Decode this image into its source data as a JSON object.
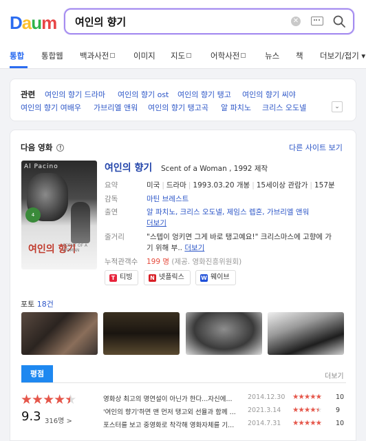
{
  "header": {
    "logo": "Daum",
    "search_value": "여인의 향기"
  },
  "tabs": [
    "통합",
    "통합웹",
    "백과사전",
    "이미지",
    "지도",
    "어학사전",
    "뉴스",
    "책",
    "더보기/접기"
  ],
  "related": {
    "title": "관련",
    "links": [
      "여인의 향기 드라마",
      "여인의 향기 ost",
      "여인의 향기 탱고",
      "여인의 향기 씨야",
      "여인의 향기 여배우",
      "가브리엘 앤워",
      "여인의 향기 탱고곡",
      "알 파치노",
      "크리스 오도넬"
    ]
  },
  "movie": {
    "section_title": "다음 영화",
    "other_site": "다른 사이트 보기",
    "poster": {
      "actor": "Al Pacino",
      "title": "여인의 향기",
      "subtitle": "SCENT OF A WOMAN",
      "badge": "4"
    },
    "title": "여인의 향기",
    "original_title": "Scent of a Woman , 1992 제작",
    "summary_label": "요약",
    "summary": {
      "country": "미국",
      "genre": "드라마",
      "release": "1993.03.20 개봉",
      "rating": "15세이상 관람가",
      "runtime": "157분"
    },
    "director_label": "감독",
    "director": "마틴 브레스트",
    "cast_label": "출연",
    "cast": "알 파치노, 크리스 오도넬, 제임스 렙혼, 가브리엘 앤워",
    "more": "더보기",
    "plot_label": "줄거리",
    "plot_line1": "\"스텝이 엉키면 그게 바로 탱고예요!\" 크리스마스에 고향에 가",
    "plot_line2": "기 위해 부..",
    "audience_label": "누적관객수",
    "audience_count": "199 명",
    "audience_source": "(제공. 영화진흥위원회)",
    "ott": [
      {
        "label": "티빙",
        "logo": "T",
        "color": "#e8233b"
      },
      {
        "label": "넷플릭스",
        "logo": "N",
        "color": "#d81f26"
      },
      {
        "label": "웨이브",
        "logo": "W",
        "color": "#1f4fd8"
      }
    ],
    "photos_label": "포토",
    "photos_count": "18건"
  },
  "reviews": {
    "tab_label": "평점",
    "more": "더보기",
    "score": "9.3",
    "count": "316명 >",
    "items": [
      {
        "text": "영화상 최고의 명연설이 아닌가 한다...자신에...",
        "date": "2014.12.30",
        "score": "10",
        "stars": 5
      },
      {
        "text": "'여인의 향기'하면 맨 먼저 탱고외 선율과 함께 ...",
        "date": "2021.3.14",
        "score": "9",
        "stars": 4.5
      },
      {
        "text": "포스터를 보고 중영화로 착각해 영화자체를 기...",
        "date": "2014.7.31",
        "score": "10",
        "stars": 5
      }
    ]
  },
  "colors": {
    "accent": "#2b6cf0",
    "link": "#2b55c7",
    "star": "#e5564a",
    "review_tab": "#1e88f0"
  }
}
